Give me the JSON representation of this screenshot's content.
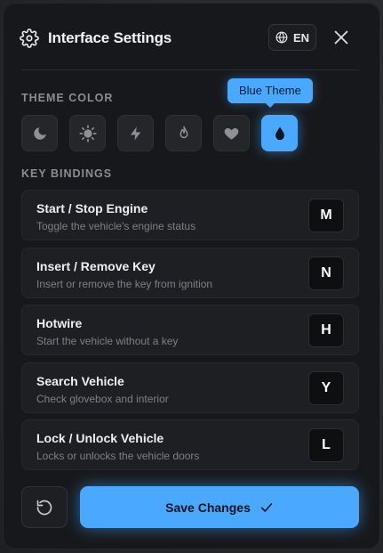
{
  "header": {
    "title": "Interface Settings",
    "language": "EN"
  },
  "theme": {
    "section_label": "THEME COLOR",
    "tooltip": "Blue Theme",
    "options": [
      {
        "icon": "moon-icon",
        "active": false
      },
      {
        "icon": "sun-icon",
        "active": false
      },
      {
        "icon": "lightning-icon",
        "active": false
      },
      {
        "icon": "fire-icon",
        "active": false
      },
      {
        "icon": "heart-icon",
        "active": false
      },
      {
        "icon": "droplet-icon",
        "active": true
      }
    ],
    "accent_color": "#4aa8ff"
  },
  "bindings": {
    "section_label": "KEY BINDINGS",
    "items": [
      {
        "name": "Start / Stop Engine",
        "desc": "Toggle the vehicle's engine status",
        "key": "M"
      },
      {
        "name": "Insert / Remove Key",
        "desc": "Insert or remove the key from ignition",
        "key": "N"
      },
      {
        "name": "Hotwire",
        "desc": "Start the vehicle without a key",
        "key": "H"
      },
      {
        "name": "Search Vehicle",
        "desc": "Check glovebox and interior",
        "key": "Y"
      },
      {
        "name": "Lock / Unlock Vehicle",
        "desc": "Locks or unlocks the vehicle doors",
        "key": "L"
      }
    ]
  },
  "footer": {
    "save_label": "Save Changes"
  }
}
